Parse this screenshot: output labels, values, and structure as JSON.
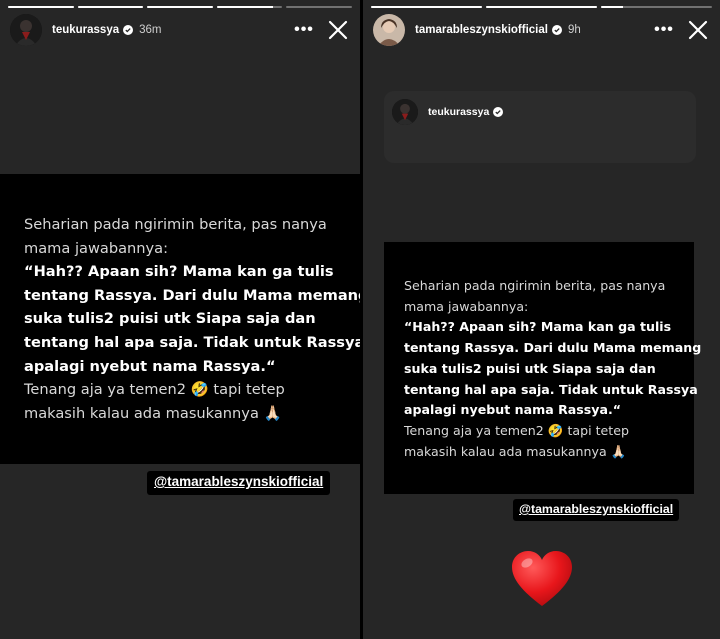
{
  "left_story": {
    "progress": [
      1,
      1,
      1,
      0.85,
      0
    ],
    "username": "teukurassya",
    "time": "36m",
    "quote_lines": [
      "Seharian pada ngirimin berita, pas nanya",
      "mama jawabannya:",
      "“Hah?? Apaan sih? Mama kan ga tulis",
      "tentang Rassya. Dari dulu Mama memang",
      "suka tulis2 puisi utk Siapa saja dan",
      "tentang hal apa saja. Tidak untuk Rassya",
      "apalagi nyebut nama Rassya.“",
      "Tenang aja ya temen2 🤣 tapi tetep",
      "makasih kalau ada masukannya 🙏🏻"
    ],
    "mention": "@tamarableszynskiofficial"
  },
  "right_story": {
    "progress": [
      1,
      1,
      0.2
    ],
    "username": "tamarableszynskiofficial",
    "time": "9h",
    "repost_username": "teukurassya",
    "quote_lines": [
      "Seharian pada ngirimin berita, pas nanya",
      "mama jawabannya:",
      "“Hah?? Apaan sih? Mama kan ga tulis",
      "tentang Rassya. Dari dulu Mama memang",
      "suka tulis2 puisi utk Siapa saja dan",
      "tentang hal apa saja. Tidak untuk Rassya",
      "apalagi nyebut nama Rassya.“",
      "Tenang aja ya temen2 🤣 tapi tetep",
      "makasih kalau ada masukannya 🙏🏻"
    ],
    "mention": "@tamarableszynskiofficial",
    "sticker": "heart-emoji"
  },
  "colors": {
    "panel_bg": "#262626",
    "card_bg": "#2c2c2c",
    "quote_bg": "#000000",
    "heart_red": "#e8161b"
  },
  "bold_line_range": [
    2,
    6
  ]
}
